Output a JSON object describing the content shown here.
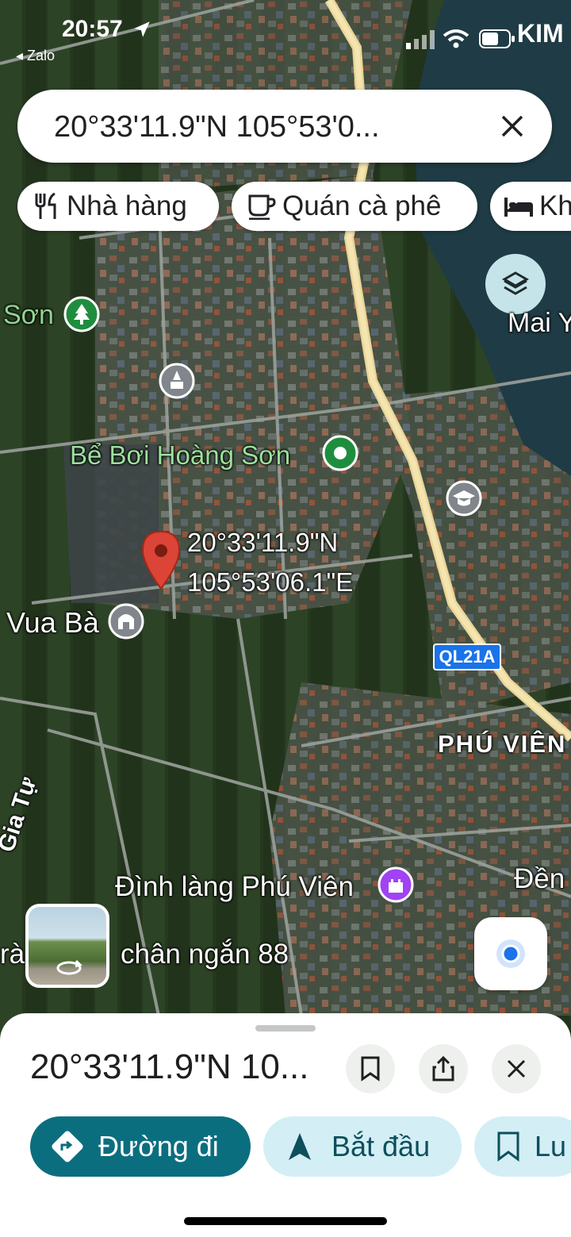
{
  "status_bar": {
    "time": "20:57",
    "back_app": "◂ Zalo",
    "carrier": "KIM"
  },
  "search": {
    "query": "20°33'11.9\"N 105°53'0..."
  },
  "chips": [
    {
      "label": "Nhà hàng",
      "icon": "utensils-icon"
    },
    {
      "label": "Quán cà phê",
      "icon": "coffee-cup-icon"
    },
    {
      "label": "Kh",
      "icon": "bed-icon"
    }
  ],
  "map": {
    "labels": {
      "son": "Sơn",
      "mai": "Mai Y",
      "be_boi": "Bể Bơi Hoàng Sơn",
      "vua_ba": "Vua Bà",
      "pin_lat": "20°33'11.9\"N",
      "pin_lng": "105°53'06.1\"E",
      "route": "QL21A",
      "phu_vien": "PHÚ VIÊN",
      "gia_tu": "Gia Tự",
      "dinh_lang": "Đình làng Phú Viên",
      "den": "Đền",
      "chan_ngan": "chân ngắn 88",
      "tra": "rà"
    },
    "colors": {
      "pin": "#db4437",
      "road": "#f2dca0",
      "river": "#1f3b45",
      "poi_park": "#1e8e3e",
      "poi_worship": "#80868b",
      "poi_school": "#80868b",
      "poi_temple": "#a142f4",
      "route_shield": "#1a73e8"
    }
  },
  "place_sheet": {
    "title": "20°33'11.9\"N 10...",
    "actions": [
      {
        "label": "Đường đi",
        "icon": "directions-icon"
      },
      {
        "label": "Bắt đầu",
        "icon": "navigation-arrow-icon"
      },
      {
        "label": "Lu",
        "icon": "bookmark-icon"
      }
    ]
  },
  "theme": {
    "primary": "#0b6e7f",
    "secondary_bg": "#d3eef5",
    "secondary_fg": "#0d4f5c"
  }
}
